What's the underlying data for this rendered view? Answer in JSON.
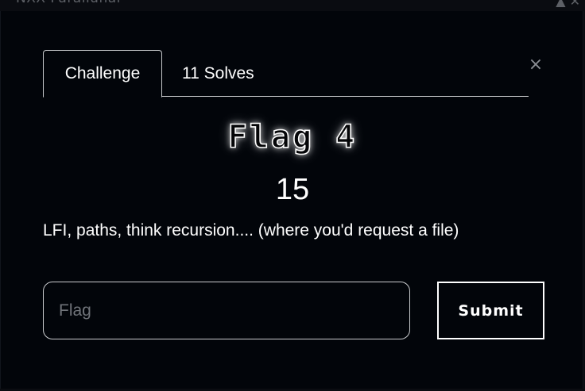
{
  "backdrop": {
    "text": "NXX   Parallunal",
    "icons": "▲ ✕"
  },
  "modal": {
    "close_symbol": "×",
    "tabs": [
      {
        "label": "Challenge",
        "active": true
      },
      {
        "label": "11 Solves",
        "active": false
      }
    ],
    "challenge": {
      "name": "Flag 4",
      "points": "15",
      "description": "LFI, paths, think recursion.... (where you'd request a file)"
    },
    "form": {
      "flag_placeholder": "Flag",
      "flag_value": "",
      "submit_label": "Submit"
    }
  }
}
